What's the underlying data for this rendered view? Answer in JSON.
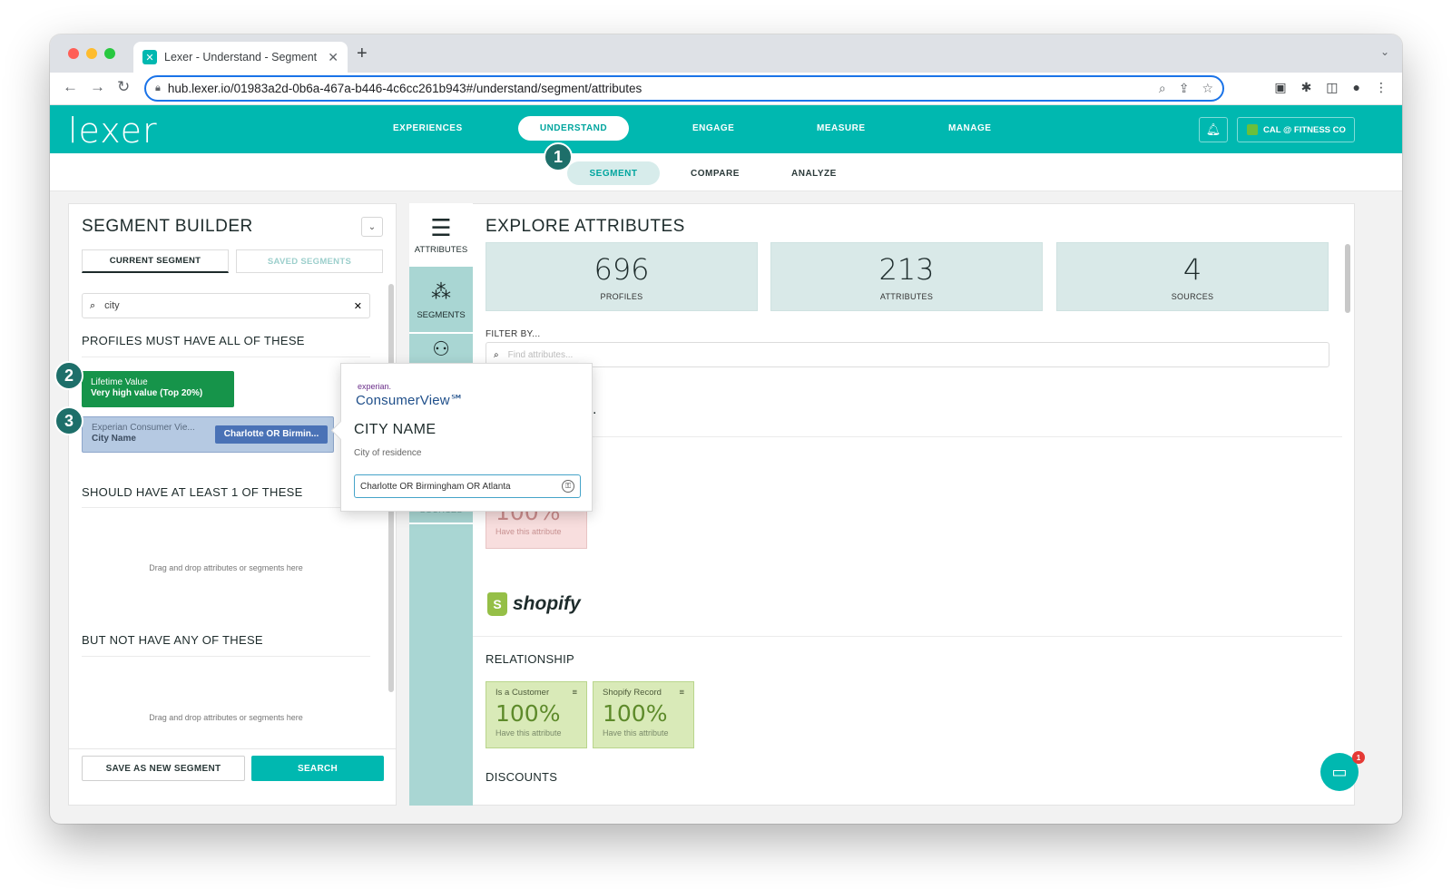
{
  "browser": {
    "tab_title": "Lexer - Understand - Segment",
    "tab_close": "✕",
    "new_tab": "+",
    "url": "hub.lexer.io/01983a2d-0b6a-467a-b446-4c6cc261b943#/understand/segment/attributes"
  },
  "app": {
    "logo": "lexer",
    "nav": {
      "experiences": "EXPERIENCES",
      "understand": "UNDERSTAND",
      "engage": "ENGAGE",
      "measure": "MEASURE",
      "manage": "MANAGE"
    },
    "account": "CAL @ FITNESS CO",
    "subnav": {
      "segment": "SEGMENT",
      "compare": "COMPARE",
      "analyze": "ANALYZE"
    }
  },
  "steps": {
    "one": "1",
    "two": "2",
    "three": "3"
  },
  "builder": {
    "title": "SEGMENT BUILDER",
    "tab_current": "CURRENT SEGMENT",
    "tab_saved": "SAVED SEGMENTS",
    "search_value": "city",
    "must_have": "PROFILES MUST HAVE ALL OF THESE",
    "chip1_line1": "Lifetime Value",
    "chip1_line2": "Very high value (Top 20%)",
    "chip2_line1": "Experian Consumer Vie...",
    "chip2_line2": "City Name",
    "chip2_value": "Charlotte OR Birmin...",
    "should_have": "SHOULD HAVE AT LEAST 1 OF THESE",
    "drop_hint": "Drag and drop attributes or segments here",
    "not_have": "BUT NOT HAVE ANY OF THESE",
    "save_btn": "SAVE AS NEW SEGMENT",
    "search_btn": "SEARCH"
  },
  "sidenav": {
    "attributes": "ATTRIBUTES",
    "segments": "SEGMENTS",
    "sources": "SOURCES"
  },
  "explore": {
    "title": "EXPLORE ATTRIBUTES",
    "stats": [
      {
        "value": "696",
        "label": "PROFILES"
      },
      {
        "value": "213",
        "label": "ATTRIBUTES"
      },
      {
        "value": "4",
        "label": "SOURCES"
      }
    ],
    "filter_label": "FILTER BY...",
    "filter_placeholder": "Find attributes...",
    "partial_text": ".",
    "red_card_pct": "100%",
    "red_card_sub": "Have this attribute",
    "shopify": "shopify",
    "relationship": "RELATIONSHIP",
    "cards": [
      {
        "name": "Is a Customer",
        "pct": "100%",
        "sub": "Have this attribute"
      },
      {
        "name": "Shopify Record",
        "pct": "100%",
        "sub": "Have this attribute"
      }
    ],
    "discounts": "DISCOUNTS"
  },
  "popover": {
    "brand_small": "experian.",
    "brand": "ConsumerView℠",
    "title": "CITY NAME",
    "subtitle": "City of residence",
    "input_value": "Charlotte OR Birmingham OR Atlanta"
  },
  "chat": {
    "badge": "1"
  },
  "colors": {
    "brand_teal": "#00b8b0",
    "chip_green": "#16944a",
    "chip_blue": "#4a72b6"
  }
}
